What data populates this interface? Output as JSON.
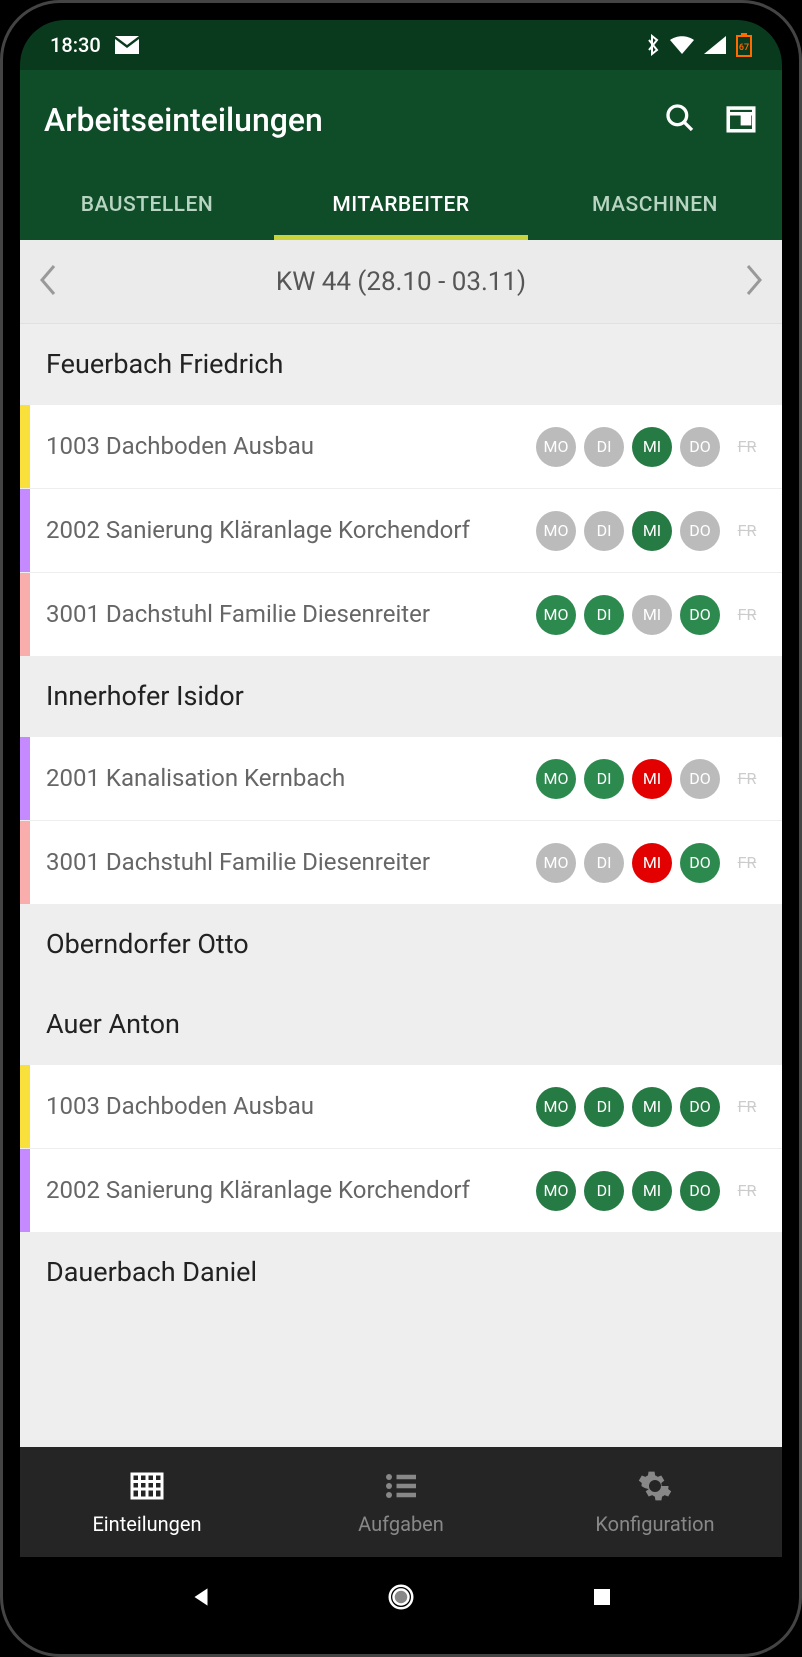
{
  "status": {
    "time": "18:30",
    "battery": "67"
  },
  "app": {
    "title": "Arbeitseinteilungen"
  },
  "tabs": {
    "t0": "BAUSTELLEN",
    "t1": "MITARBEITER",
    "t2": "MASCHINEN"
  },
  "week": {
    "label": "KW 44 (28.10 - 03.11)"
  },
  "days": {
    "mo": "MO",
    "di": "DI",
    "mi": "MI",
    "do": "DO",
    "fr": "FR"
  },
  "employees": {
    "e0": {
      "name": "Feuerbach Friedrich"
    },
    "e1": {
      "name": "Innerhofer Isidor"
    },
    "e2": {
      "name": "Oberndorfer Otto"
    },
    "e3": {
      "name": "Auer Anton"
    },
    "e4": {
      "name": "Dauerbach Daniel"
    }
  },
  "assignments": {
    "a0": {
      "name": "1003 Dachboden Ausbau",
      "color": "#f9e03a"
    },
    "a1": {
      "name": "2002 Sanierung Kläranlage Korchendorf",
      "color": "#c58aff"
    },
    "a2": {
      "name": "3001 Dachstuhl Familie Diesenreiter",
      "color": "#f9aead"
    },
    "a3": {
      "name": "2001 Kanalisation Kernbach",
      "color": "#c58aff"
    },
    "a4": {
      "name": "3001 Dachstuhl Familie Diesenreiter",
      "color": "#f9aead"
    },
    "a5": {
      "name": "1003 Dachboden Ausbau",
      "color": "#f9e03a"
    },
    "a6": {
      "name": "2002 Sanierung Kläranlage Korchendorf",
      "color": "#c58aff"
    }
  },
  "nav": {
    "n0": "Einteilungen",
    "n1": "Aufgaben",
    "n2": "Konfiguration"
  }
}
